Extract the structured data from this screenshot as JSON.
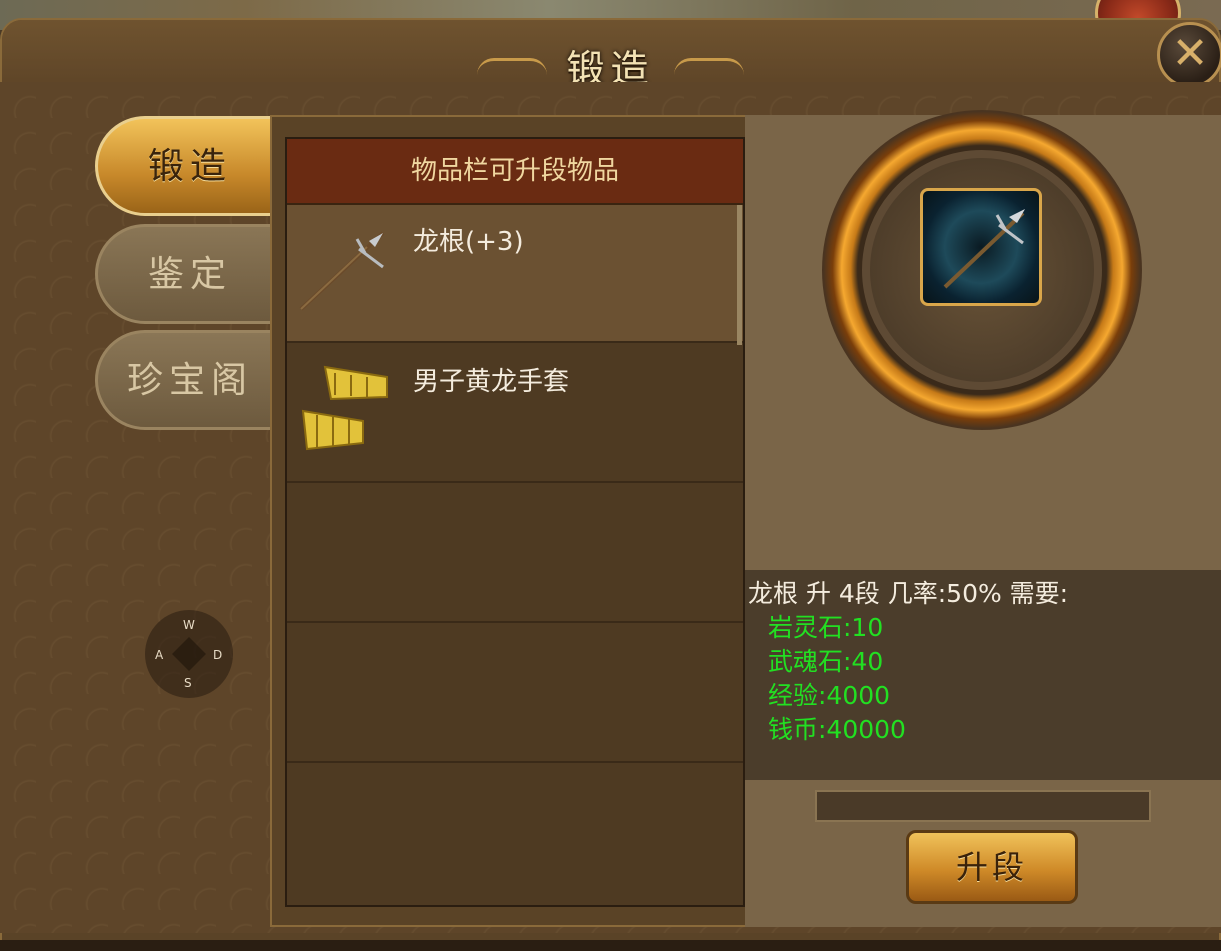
{
  "window": {
    "title": "锻造",
    "close_icon": "close-icon"
  },
  "tabs": [
    {
      "label": "锻造",
      "active": true
    },
    {
      "label": "鉴定",
      "active": false
    },
    {
      "label": "珍宝阁",
      "active": false
    }
  ],
  "joystick": {
    "up": "W",
    "left": "A",
    "right": "D",
    "down": "S"
  },
  "list": {
    "header": "物品栏可升段物品",
    "items": [
      {
        "name": "龙根(+3)",
        "icon": "spear-icon",
        "selected": true
      },
      {
        "name": "男子黄龙手套",
        "icon": "gauntlet-icon",
        "selected": false
      }
    ]
  },
  "detail": {
    "summary": "龙根 升 4段 几率:50% 需要:",
    "requirements": [
      "岩灵石:10",
      "武魂石:40",
      "经验:4000",
      "钱币:40000"
    ],
    "slot_icon": "spear-icon",
    "upgrade_label": "升段"
  },
  "colors": {
    "requirement_text": "#22e022",
    "header_bg": "#6a2b12",
    "accent_gold": "#f0c25a"
  }
}
